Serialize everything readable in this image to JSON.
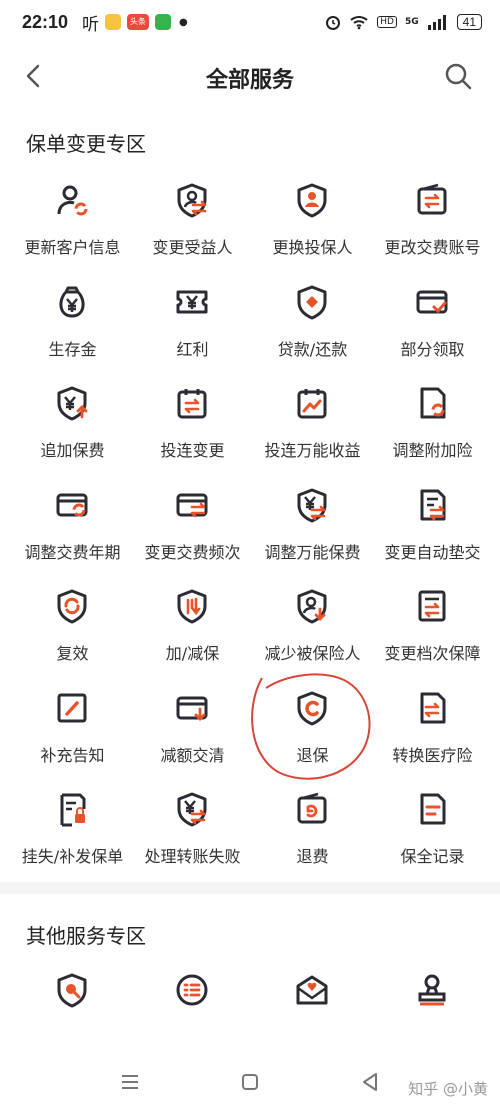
{
  "status_bar": {
    "time": "22:10",
    "carrier": "听",
    "app_badge": "头条",
    "battery": "41",
    "network": "5G",
    "hd": "HD"
  },
  "header": {
    "title": "全部服务",
    "back_icon": "chevron-left-icon",
    "search_icon": "search-icon"
  },
  "sections": [
    {
      "title": "保单变更专区",
      "items": [
        {
          "label": "更新客户信息",
          "icon": "user-refresh-icon"
        },
        {
          "label": "变更受益人",
          "icon": "shield-user-swap-icon"
        },
        {
          "label": "更换投保人",
          "icon": "shield-person-icon"
        },
        {
          "label": "更改交费账号",
          "icon": "wallet-swap-icon"
        },
        {
          "label": "生存金",
          "icon": "money-bag-icon"
        },
        {
          "label": "红利",
          "icon": "yen-ticket-icon"
        },
        {
          "label": "贷款/还款",
          "icon": "shield-diamond-icon"
        },
        {
          "label": "部分领取",
          "icon": "card-check-icon"
        },
        {
          "label": "追加保费",
          "icon": "shield-yen-up-icon"
        },
        {
          "label": "投连变更",
          "icon": "calendar-swap-icon"
        },
        {
          "label": "投连万能收益",
          "icon": "calendar-trend-icon"
        },
        {
          "label": "调整附加险",
          "icon": "document-refresh-icon"
        },
        {
          "label": "调整交费年期",
          "icon": "card-refresh-icon"
        },
        {
          "label": "变更交费频次",
          "icon": "card-swap-icon"
        },
        {
          "label": "调整万能保费",
          "icon": "shield-yen-swap-icon"
        },
        {
          "label": "变更自动垫交",
          "icon": "document-swap-icon"
        },
        {
          "label": "复效",
          "icon": "shield-refresh-icon"
        },
        {
          "label": "加/减保",
          "icon": "shield-updown-icon"
        },
        {
          "label": "减少被保险人",
          "icon": "shield-user-down-icon"
        },
        {
          "label": "变更档次保障",
          "icon": "document-arrows-icon"
        },
        {
          "label": "补充告知",
          "icon": "edit-box-icon"
        },
        {
          "label": "减额交清",
          "icon": "card-down-icon"
        },
        {
          "label": "退保",
          "icon": "shield-c-icon"
        },
        {
          "label": "转换医疗险",
          "icon": "document-exchange-icon"
        },
        {
          "label": "挂失/补发保单",
          "icon": "shield-lock-icon"
        },
        {
          "label": "处理转账失败",
          "icon": "shield-yen-exchange-icon"
        },
        {
          "label": "退费",
          "icon": "wallet-return-icon"
        },
        {
          "label": "保全记录",
          "icon": "document-lines-icon"
        }
      ]
    },
    {
      "title": "其他服务专区",
      "items": [
        {
          "label": "",
          "icon": "shield-search-icon"
        },
        {
          "label": "",
          "icon": "list-circle-icon"
        },
        {
          "label": "",
          "icon": "mail-heart-icon"
        },
        {
          "label": "",
          "icon": "stamp-icon"
        }
      ]
    }
  ],
  "watermark": "知乎 @小黄",
  "colors": {
    "primary": "#e8532a",
    "icon_dark": "#2b2b33",
    "annotation": "#d9453a"
  }
}
